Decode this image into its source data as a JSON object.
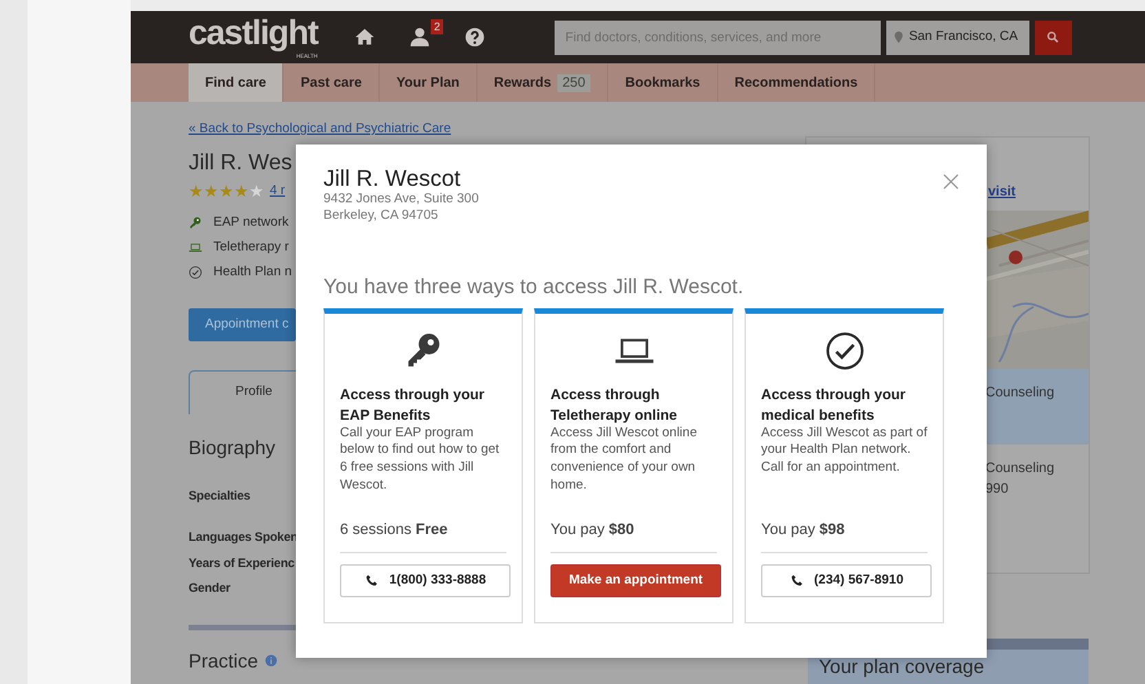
{
  "header": {
    "logo": "castlight",
    "logo_sub": "HEALTH",
    "notifications_badge": "2",
    "search": {
      "placeholder": "Find doctors, conditions, services, and more"
    },
    "location": "San Francisco, CA"
  },
  "nav": [
    {
      "label": "Find care",
      "selected": true
    },
    {
      "label": "Past care",
      "selected": false
    },
    {
      "label": "Your Plan",
      "selected": false
    },
    {
      "label": "Rewards",
      "badge": "250",
      "selected": false
    },
    {
      "label": "Bookmarks",
      "selected": false
    },
    {
      "label": "Recommendations",
      "selected": false
    }
  ],
  "back_link": "« Back to Psychological and Psychiatric Care",
  "profile": {
    "name": "Jill R. Wes",
    "stars": 4,
    "reviews": "4 r",
    "features": [
      {
        "kind": "key",
        "label": "EAP network"
      },
      {
        "kind": "laptop",
        "label": "Teletherapy r"
      },
      {
        "kind": "check",
        "label": "Health Plan n"
      }
    ],
    "appointment_button": "Appointment c",
    "tab": "Profile",
    "biography_heading": "Biography",
    "fields": [
      "Specialties",
      "Languages Spoken",
      "Years of Experienc",
      "Gender"
    ],
    "practice_heading": "Practice"
  },
  "side_panel": {
    "link": "visit",
    "rows": [
      {
        "texts": [
          "Counseling"
        ],
        "selected": true
      },
      {
        "texts": [
          "Counseling",
          "990"
        ],
        "selected": false
      }
    ],
    "coverage_heading": "Your plan coverage"
  },
  "modal": {
    "name": "Jill R. Wescot",
    "address": [
      "9432 Jones Ave, Suite 300",
      "Berkeley, CA 94705"
    ],
    "heading": "You have three ways to access Jill R. Wescot.",
    "options": [
      {
        "kind": "key",
        "title": "Access through your EAP Benefits",
        "description": "Call your EAP program below to find out how to get 6 free sessions with Jill Wescot.",
        "price_label": "6 sessions",
        "price": "Free",
        "action": {
          "kind": "phone",
          "label": "1(800) 333-8888"
        }
      },
      {
        "kind": "laptop",
        "title": "Access through Teletherapy online",
        "description": "Access Jill Wescot online from the comfort and convenience of your own home.",
        "price_label": "You pay",
        "price": "$80",
        "action": {
          "kind": "primary",
          "label": "Make an appointment"
        }
      },
      {
        "kind": "check",
        "title": "Access through your medical benefits",
        "description": "Access Jill Wescot as part of your Health Plan network. Call for an appointment.",
        "price_label": "You pay",
        "price": "$98",
        "action": {
          "kind": "phone",
          "label": "(234) 567-8910"
        }
      }
    ]
  }
}
